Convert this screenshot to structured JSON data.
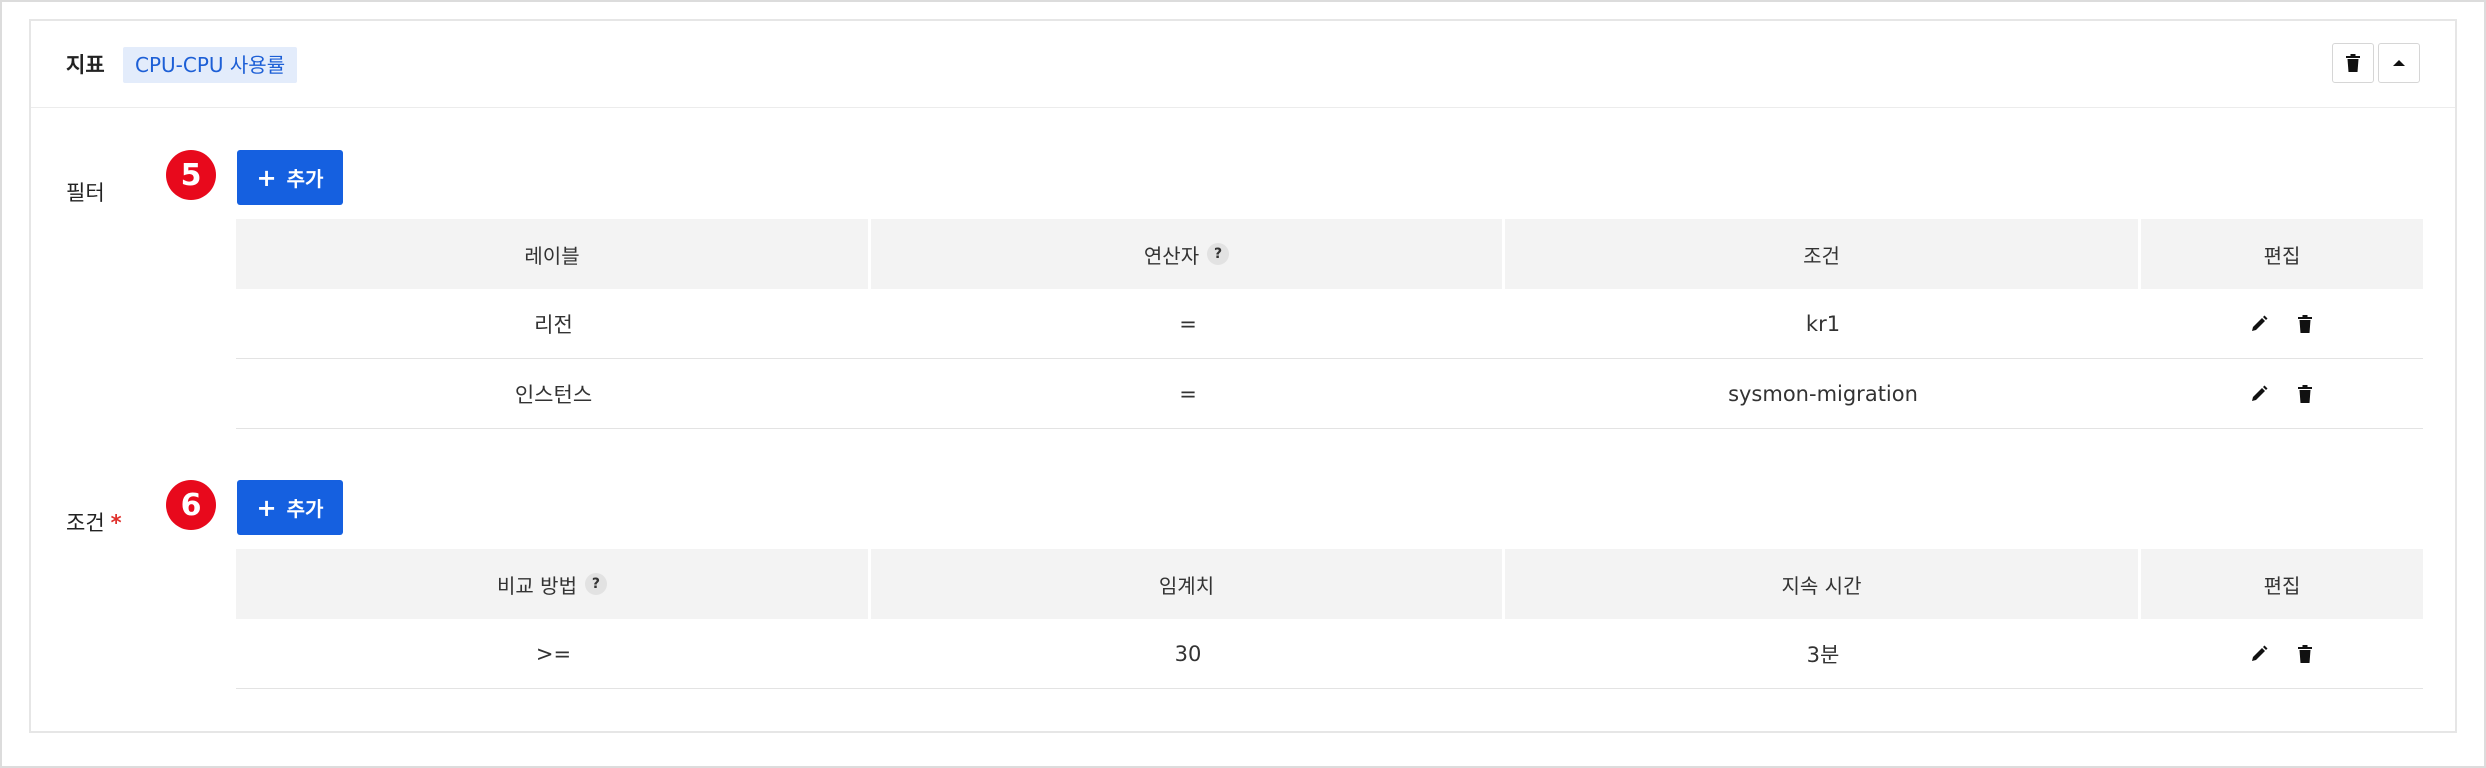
{
  "header": {
    "label": "지표",
    "metric": "CPU-CPU 사용률",
    "icons": {
      "delete": "trash-icon",
      "collapse": "caret-up-icon"
    }
  },
  "filter_section": {
    "label": "필터",
    "step": "5",
    "add_label": "추가",
    "add_symbol": "+",
    "columns": [
      "레이블",
      "연산자",
      "조건",
      "편집"
    ],
    "help_symbol": "?",
    "rows": [
      {
        "label": "리전",
        "operator": "=",
        "condition": "kr1"
      },
      {
        "label": "인스턴스",
        "operator": "=",
        "condition": "sysmon-migration"
      }
    ]
  },
  "condition_section": {
    "label": "조건",
    "required": "*",
    "step": "6",
    "add_label": "추가",
    "add_symbol": "+",
    "columns": [
      "비교 방법",
      "임계치",
      "지속 시간",
      "편집"
    ],
    "help_symbol": "?",
    "rows": [
      {
        "comparison": ">=",
        "threshold": "30",
        "duration": "3분"
      }
    ]
  },
  "colors": {
    "primary": "#1560e0",
    "badge": "#e8091c",
    "chip_bg": "#e3ecfb",
    "chip_text": "#1d5fd6",
    "required": "#e0302b"
  }
}
